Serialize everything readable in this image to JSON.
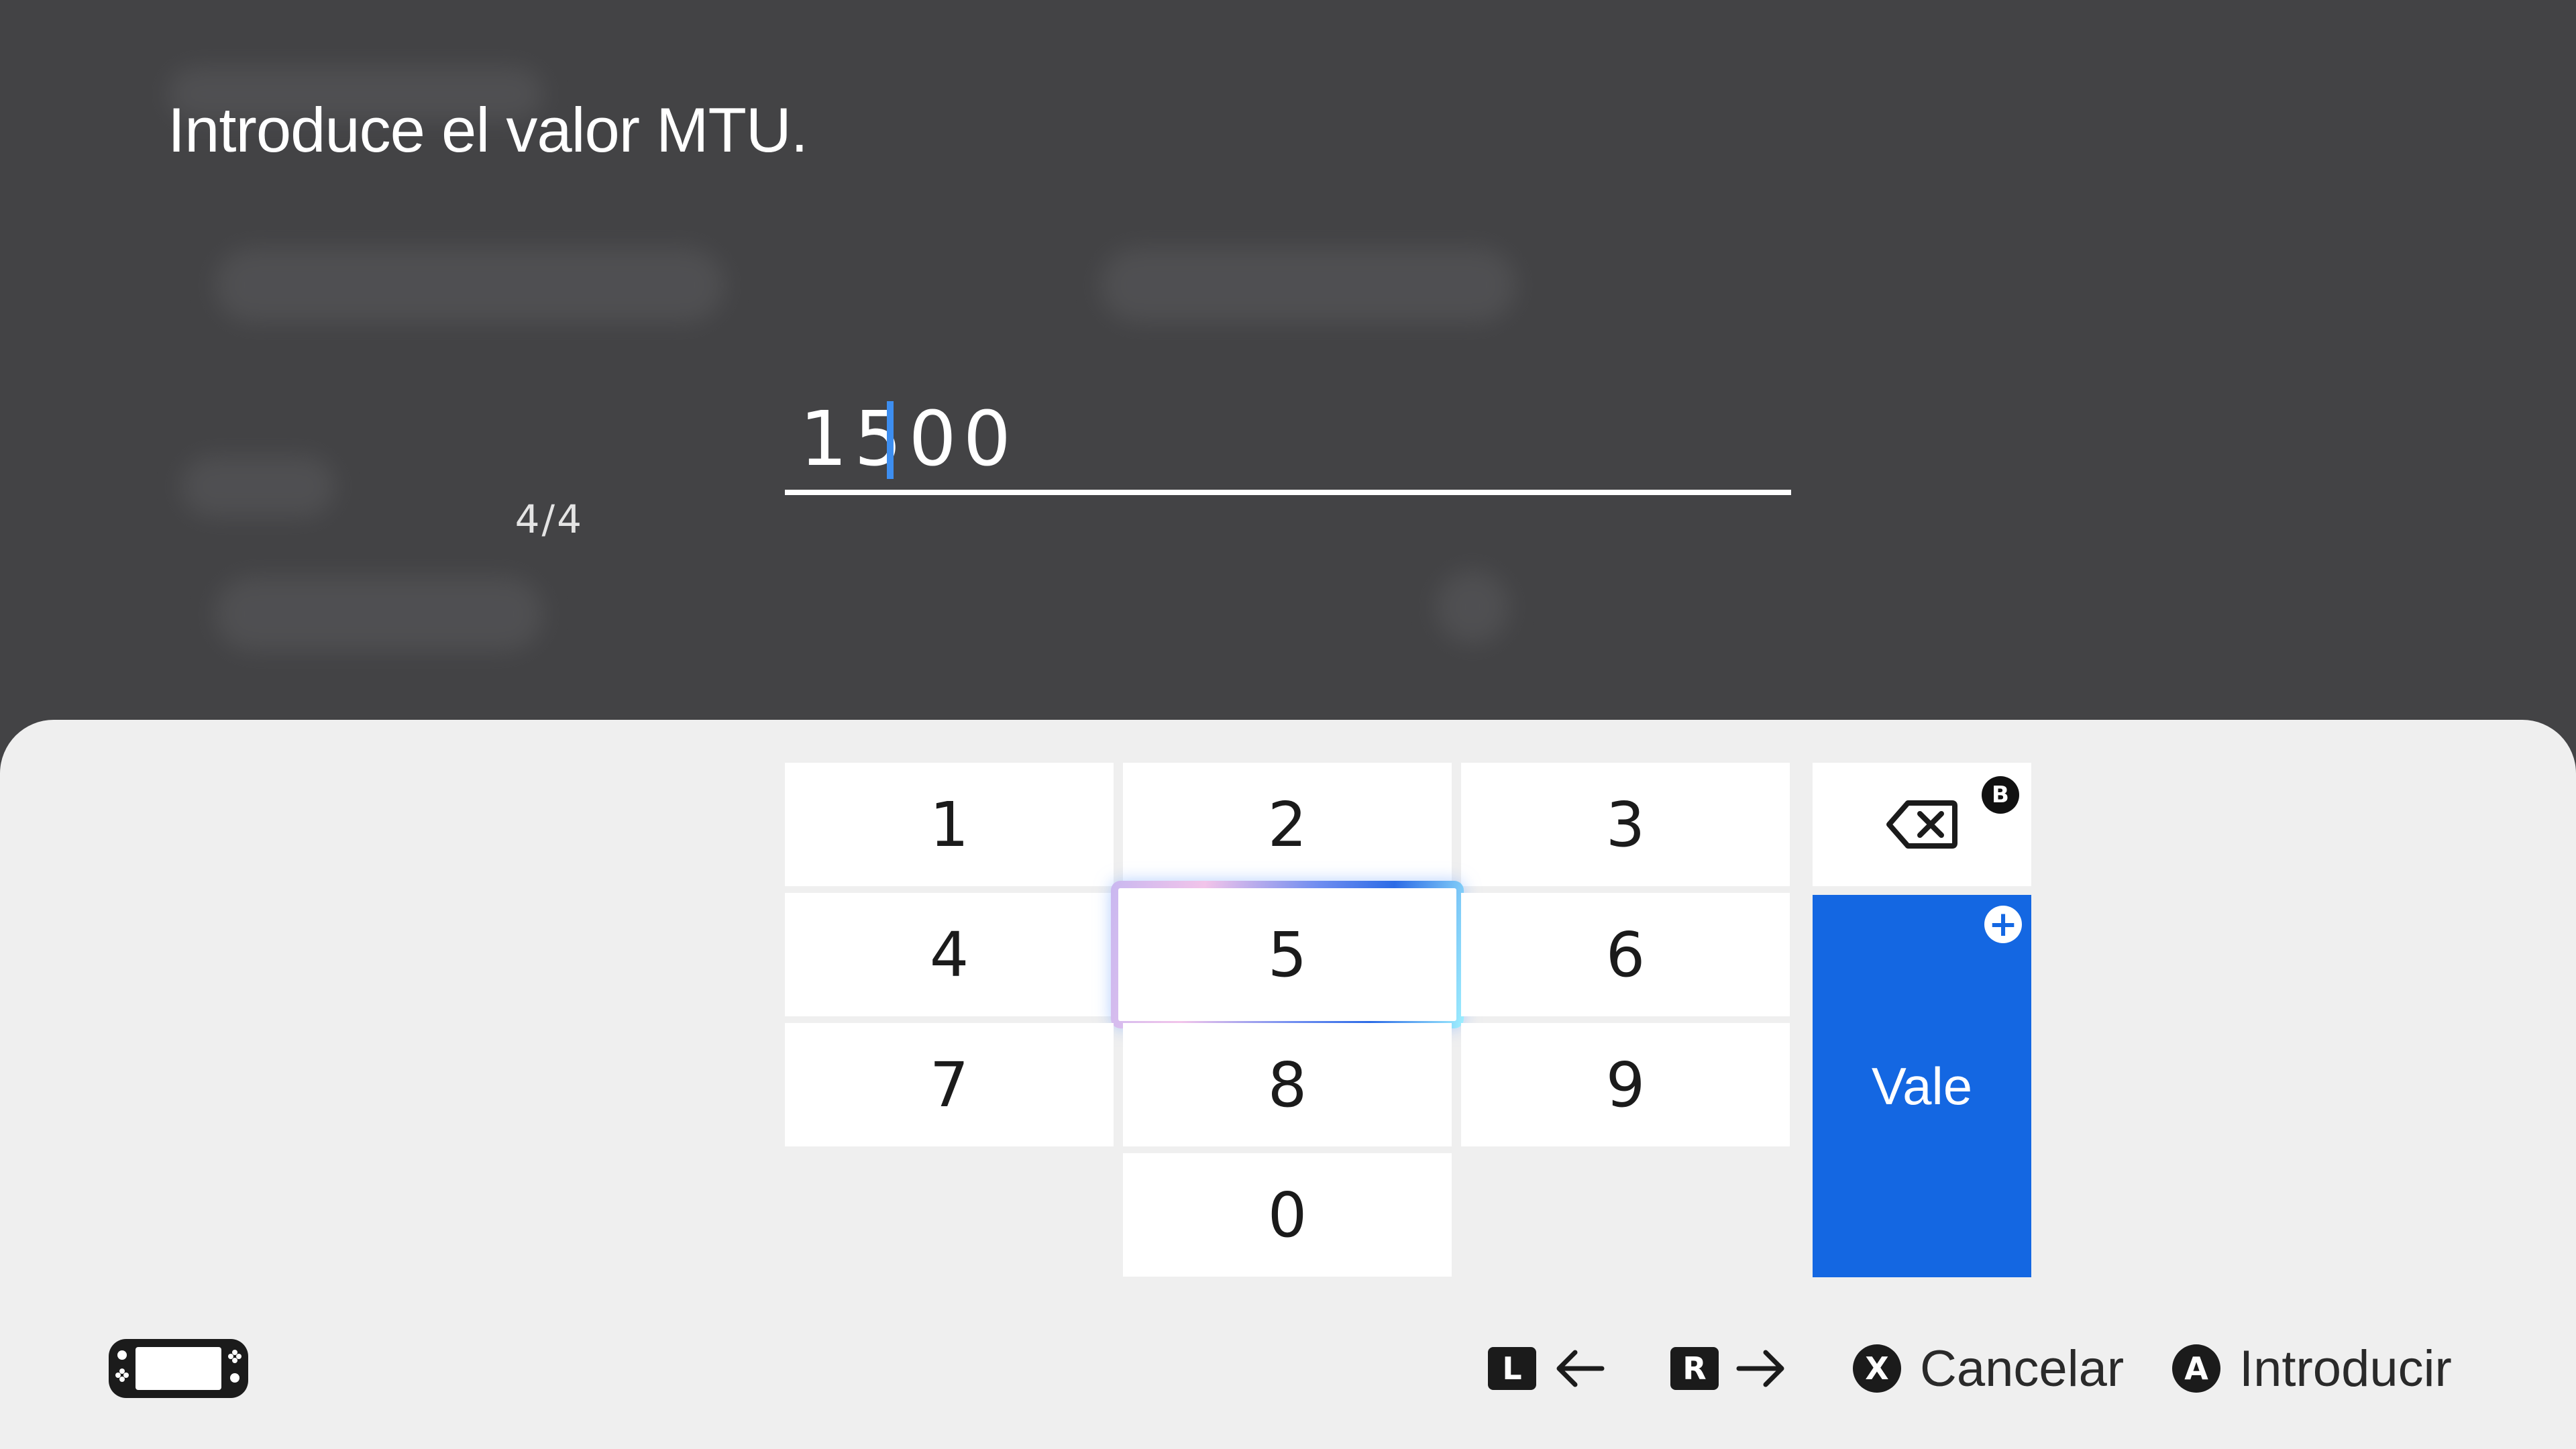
{
  "prompt": "Introduce el valor MTU.",
  "input": {
    "value": "1500",
    "counter": "4/4"
  },
  "keypad": {
    "keys": [
      "1",
      "2",
      "3",
      "4",
      "5",
      "6",
      "7",
      "8",
      "9",
      "0"
    ],
    "selected_key": "5",
    "ok_label": "Vale",
    "backspace_badge": "B"
  },
  "footer": {
    "left_button": "L",
    "right_button": "R",
    "cancel_button": "X",
    "cancel_label": "Cancelar",
    "enter_button": "A",
    "enter_label": "Introducir"
  },
  "colors": {
    "background": "#434345",
    "panel": "#efefef",
    "accent": "#1467e2",
    "caret": "#3d8ef0"
  },
  "icons": [
    "backspace-icon",
    "plus-icon",
    "console-handheld-icon",
    "arrow-left-icon",
    "arrow-right-icon"
  ]
}
